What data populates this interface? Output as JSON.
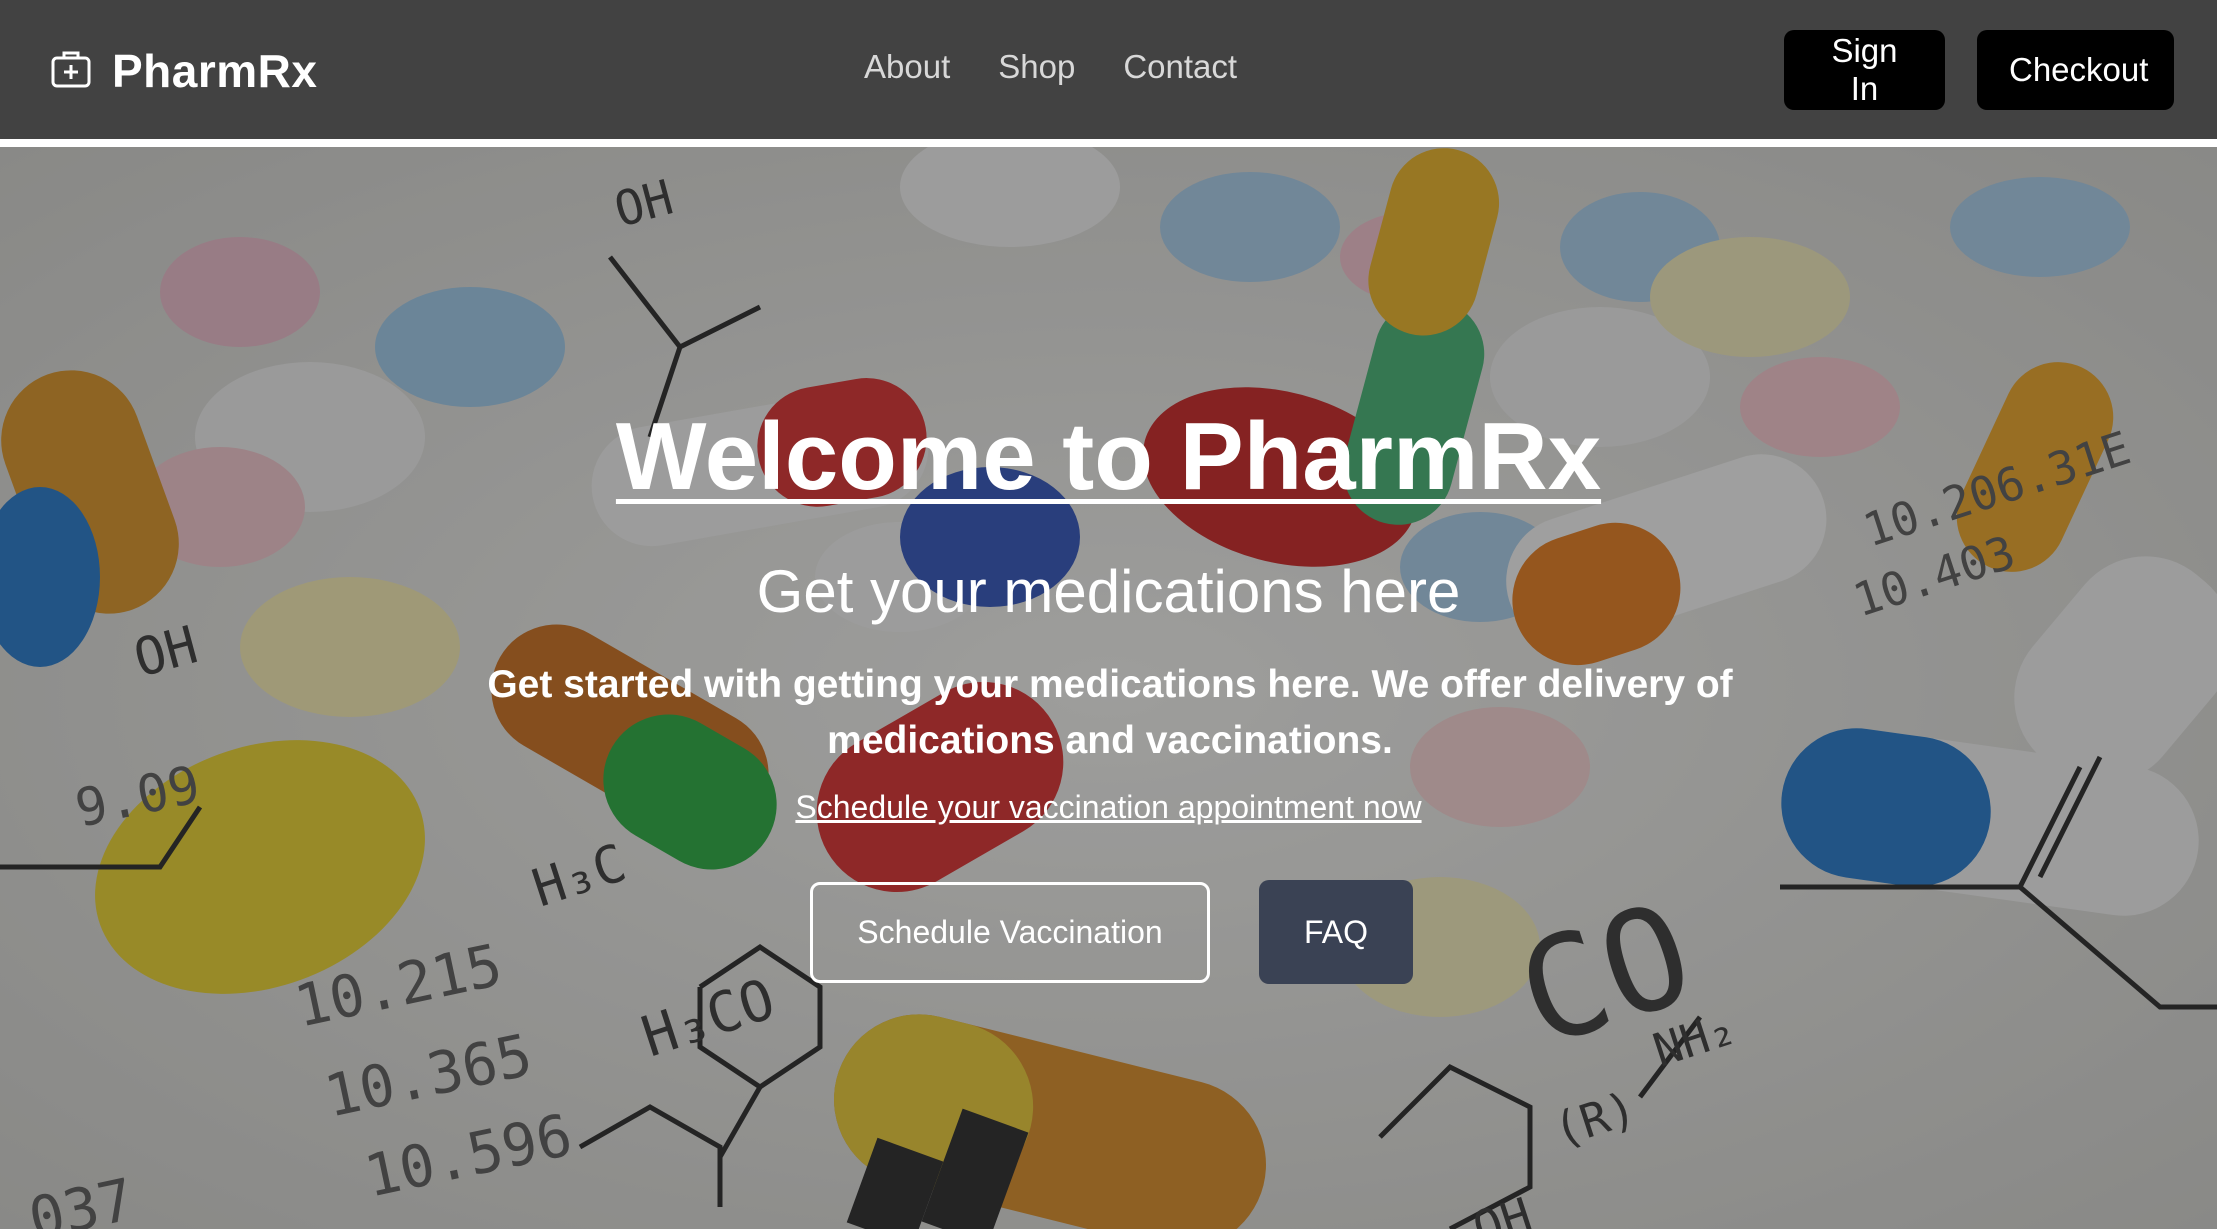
{
  "brand": {
    "name": "PharmRx",
    "icon": "medical-kit-icon"
  },
  "nav": {
    "links": [
      "About",
      "Shop",
      "Contact"
    ],
    "signin_label": "Sign In",
    "checkout_label": "Checkout"
  },
  "hero": {
    "title": "Welcome to PharmRx",
    "subtitle": "Get your medications here",
    "description": "Get started with getting your medications here. We offer delivery of medications and vaccinations.",
    "link_text": "Schedule your vaccination appointment now",
    "primary_button": "Schedule Vaccination",
    "secondary_button": "FAQ",
    "background": "pills-and-chemical-formulas-photo"
  },
  "colors": {
    "navbar": "#424242",
    "faq_button": "#3a4254",
    "nav_buttons": "#000000"
  }
}
